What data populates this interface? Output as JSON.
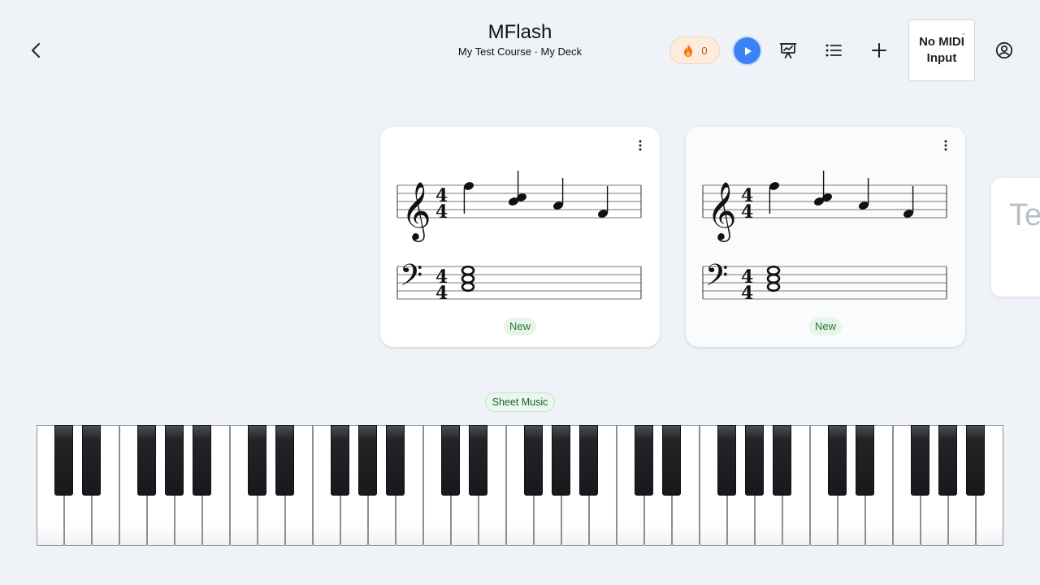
{
  "header": {
    "title": "MFlash",
    "subtitle": "My Test Course · My Deck",
    "streak_count": "0",
    "midi_select_value": "No MIDI Input"
  },
  "icons": {
    "back": "chevron-left-icon",
    "streak": "fire-icon",
    "play": "play-icon",
    "stats": "presentation-chart-icon",
    "list": "list-icon",
    "add": "plus-icon",
    "account": "user-circle-icon",
    "card_menu": "more-vertical-icon"
  },
  "cards": [
    {
      "status": "New",
      "time_signature": "4/4"
    },
    {
      "status": "New",
      "time_signature": "4/4"
    }
  ],
  "peek_card": {
    "text": "Te"
  },
  "mode": {
    "label": "Sheet Music"
  },
  "keyboard": {
    "white_key_count": 35
  },
  "colors": {
    "background": "#eff3f8",
    "accent": "#3b82f6",
    "new_badge_bg": "#e6f4ea",
    "new_badge_text": "#1e7a3a"
  }
}
